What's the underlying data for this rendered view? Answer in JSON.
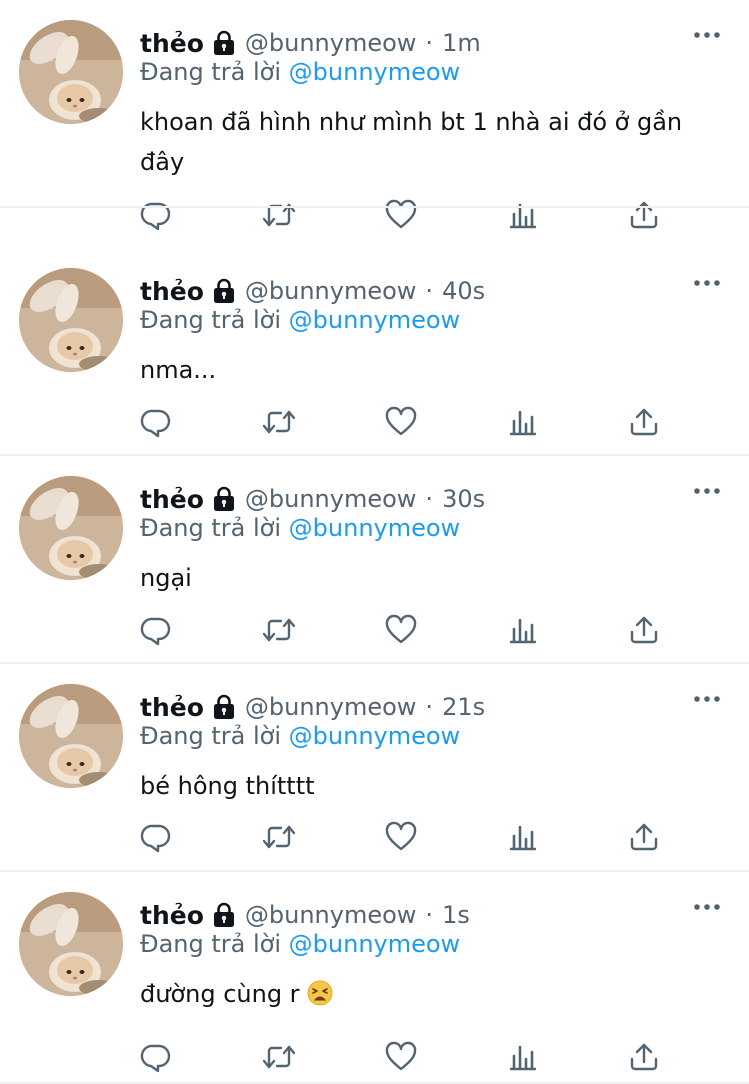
{
  "tweets": [
    {
      "display_name": "thẻo",
      "handle": "@bunnymeow",
      "separator": "·",
      "time": "1m",
      "reply_prefix": "Đang trả lời",
      "reply_to": "@bunnymeow",
      "text": "khoan đã hình như mình bt 1 nhà ai đó ở gần đây",
      "emoji": ""
    },
    {
      "display_name": "thẻo",
      "handle": "@bunnymeow",
      "separator": "·",
      "time": "40s",
      "reply_prefix": "Đang trả lời",
      "reply_to": "@bunnymeow",
      "text": "nma...",
      "emoji": ""
    },
    {
      "display_name": "thẻo",
      "handle": "@bunnymeow",
      "separator": "·",
      "time": "30s",
      "reply_prefix": "Đang trả lời",
      "reply_to": "@bunnymeow",
      "text": "ngại",
      "emoji": ""
    },
    {
      "display_name": "thẻo",
      "handle": "@bunnymeow",
      "separator": "·",
      "time": "21s",
      "reply_prefix": "Đang trả lời",
      "reply_to": "@bunnymeow",
      "text": "bé hông thítttt",
      "emoji": ""
    },
    {
      "display_name": "thẻo",
      "handle": "@bunnymeow",
      "separator": "·",
      "time": "1s",
      "reply_prefix": "Đang trả lời",
      "reply_to": "@bunnymeow",
      "text": "đường cùng r",
      "emoji": "tired-face-emoji"
    }
  ],
  "icons": {
    "lock": "lock-icon",
    "more": "more-icon",
    "reply": "reply-icon",
    "retweet": "retweet-icon",
    "like": "heart-icon",
    "analytics": "analytics-icon",
    "share": "share-icon"
  },
  "colors": {
    "name": "#0f1419",
    "secondary": "#536471",
    "mention": "#1d9bf0",
    "divider": "#eef0f2"
  }
}
